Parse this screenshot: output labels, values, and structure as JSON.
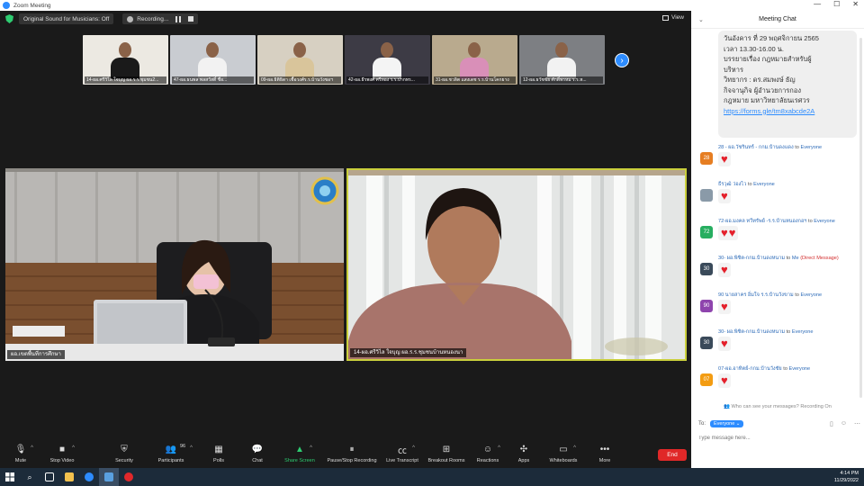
{
  "window": {
    "title": "Zoom Meeting",
    "controls": [
      "—",
      "☐",
      "✕"
    ]
  },
  "topbar": {
    "original_sound": "Original Sound for Musicians: Off",
    "recording": "Recording...",
    "view": "View"
  },
  "gallery": [
    {
      "name": "14-ผอ.ศรีวิไล ใจบุญ ผอ.ร.ร.ชุมชน2...",
      "bg": "#ece9e2",
      "shirt": "#1a1a1a"
    },
    {
      "name": "47-ผอ.ธนพล พลสวัสดิ์ ชื่อ...",
      "bg": "#c9ccd1",
      "shirt": "#f2f2f2"
    },
    {
      "name": "09-ผอ.ธิติธิดา เชื้อวงศ์ร.ร.บ้านวังชอฯ",
      "bg": "#d7d0c2",
      "shirt": "#d9c59b"
    },
    {
      "name": "42-ผอ.ธีรพงศ์ ศรีทอง ร.ร.ปากทร...",
      "bg": "#3d3b45",
      "shirt": "#f4f4f4"
    },
    {
      "name": "31-ผอ.ชวลิต แสงเดช ร.ร.บ้านโคกยาง",
      "bg": "#b9aa8e",
      "shirt": "#d98fb8"
    },
    {
      "name": "12-ผอ.ธวัชชัย ศักดิ์พรหม ร.ร.ห...",
      "bg": "#7d7f83",
      "shirt": "#f2f2f2"
    }
  ],
  "videos": {
    "left_name": "ผอ.เขตพื้นที่การศึกษา",
    "right_name": "14-ผอ.ศรีวิไล ใจบุญ ผอ.ร.ร.ชุมชนบ้านหนองนา"
  },
  "toolbar": {
    "mute": "Mute",
    "stop_video": "Stop Video",
    "security": "Security",
    "participants": "Participants",
    "participants_count": "96",
    "polls": "Polls",
    "chat": "Chat",
    "share_screen": "Share Screen",
    "pause_recording": "Pause/Stop Recording",
    "live_transcript": "Live Transcript",
    "breakout": "Breakout Rooms",
    "reactions": "Reactions",
    "apps": "Apps",
    "whiteboards": "Whiteboards",
    "more": "More",
    "end": "End",
    "accent_share": "#2ecc71",
    "accent_end": "#e02828"
  },
  "chat": {
    "title": "Meeting Chat",
    "pinned_lines": [
      "วันอังคาร ที่ 29 พฤศจิกายน 2565",
      "เวลา 13.30-16.00 น.",
      "บรรยายเรื่อง กฎหมายสำหรับผู้",
      "บริหาร",
      "วิทยากร : ดร.สมพงษ์ ธัญ",
      "กิจจานุกิจ ผู้อำนวยการกอง",
      "กฎหมาย มหาวิทยาลัยนเรศวร"
    ],
    "pinned_link": "https://forms.gle/tm8xabcde2A",
    "messages": [
      {
        "sender": "28 - ผอ.วัชรินทร์ - กกม.บ้านดงแดง",
        "to": "to",
        "target": "Everyone",
        "avatar": "28",
        "avatar_color": "#e67e22",
        "hearts": 1,
        "dm": false
      },
      {
        "sender": "ธีรวุฒิ ว่องไว",
        "to": "to",
        "target": "Everyone",
        "avatar": "",
        "avatar_color": "#8a9aa8",
        "hearts": 1,
        "dm": false
      },
      {
        "sender": "72-ผอ.มงคล ทวีทรัพย์ -ร.ร.บ้านหนองกอฯ",
        "to": "to",
        "target": "Everyone",
        "avatar": "72",
        "avatar_color": "#27ae60",
        "hearts": 2,
        "dm": false
      },
      {
        "sender": "30- ผอ.พิชิต-กกม.บ้านดงหนาม",
        "to": "to",
        "target": "Me",
        "dm_label": "(Direct Message)",
        "avatar": "30",
        "avatar_color": "#3a4a5a",
        "hearts": 1,
        "dm": true
      },
      {
        "sender": "90 นายสาคร อิ่มใจ ร.ร.บ้านวังขาม",
        "to": "to",
        "target": "Everyone",
        "avatar": "90",
        "avatar_color": "#8e44ad",
        "hearts": 1,
        "dm": false
      },
      {
        "sender": "30- ผอ.พิชิต-กกม.บ้านดงหนาม",
        "to": "to",
        "target": "Everyone",
        "avatar": "30",
        "avatar_color": "#3a4a5a",
        "hearts": 1,
        "dm": false
      },
      {
        "sender": "07-ผอ.อาทิตย์-กกม.บ้านวังชัย",
        "to": "to",
        "target": "Everyone",
        "avatar": "07",
        "avatar_color": "#f39c12",
        "hearts": 1,
        "dm": false
      }
    ],
    "who_can_see": "Who can see your messages? Recording On",
    "to_label": "To:",
    "to_target": "Everyone",
    "input_placeholder": "Type message here..."
  },
  "taskbar": {
    "time": "4:14 PM",
    "date": "11/29/2022"
  }
}
